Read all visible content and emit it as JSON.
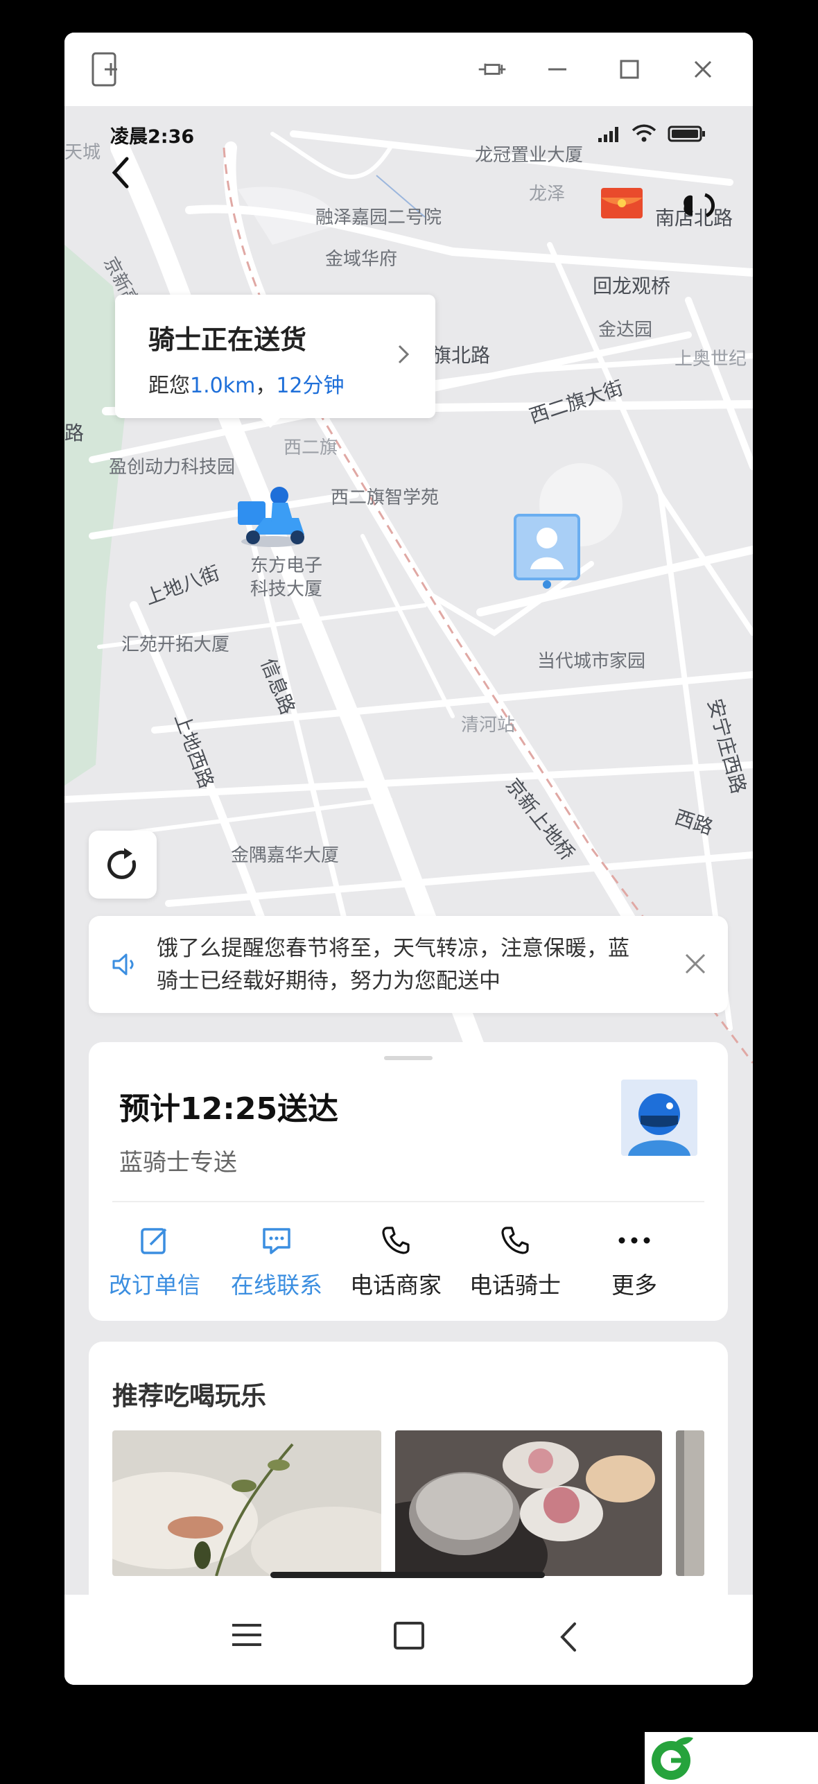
{
  "status_bar": {
    "time": "凌晨2:36"
  },
  "map": {
    "labels": {
      "tiancheng": "天城",
      "jingxin_highway": "京新高速",
      "longguan": "龙冠置业大厦",
      "longze": "龙泽",
      "nandian_north": "南店北路",
      "ronzejiayuan": "融泽嘉园二号院",
      "jinyu": "金域华府",
      "huilong": "回龙观桥",
      "jinda": "金达园",
      "shangao": "上奥世纪",
      "qi_north": "旗北路",
      "xiqi_street": "西二旗大街",
      "road_left": "路",
      "xierqi": "西二旗",
      "yingchuang": "盈创动力科技园",
      "zhixueyuan": "西二旗智学苑",
      "shangdi8": "上地八街",
      "dongfang1": "东方电子",
      "dongfang2": "科技大厦",
      "huiyuan": "汇苑开拓大厦",
      "xinxi": "信息路",
      "dangdai": "当代城市家园",
      "anning": "安宁庄西路",
      "qinghe": "清河站",
      "shangdi_west": "上地西路",
      "jingxin_shangdi": "京新上地桥",
      "xi_road": "西路",
      "jinyu_jiahua": "金隅嘉华大厦"
    }
  },
  "rider_card": {
    "title": "骑士正在送货",
    "sub_prefix": "距您",
    "distance": "1.0km",
    "sep": "，",
    "minutes": "12分钟"
  },
  "notice": {
    "text": "饿了么提醒您春节将至，天气转凉，注意保暖，蓝骑士已经载好期待，努力为您配送中"
  },
  "delivery": {
    "eta": "预计12:25送达",
    "type": "蓝骑士专送",
    "actions": [
      {
        "label": "改订单信",
        "icon": "edit-icon"
      },
      {
        "label": "在线联系",
        "icon": "chat-icon"
      },
      {
        "label": "电话商家",
        "icon": "phone-icon"
      },
      {
        "label": "电话骑士",
        "icon": "phone-icon"
      },
      {
        "label": "更多",
        "icon": "more-icon"
      }
    ]
  },
  "recommend": {
    "title": "推荐吃喝玩乐"
  },
  "colors": {
    "accent_blue": "#1e6fd9",
    "action_blue": "#3b8ee0"
  }
}
